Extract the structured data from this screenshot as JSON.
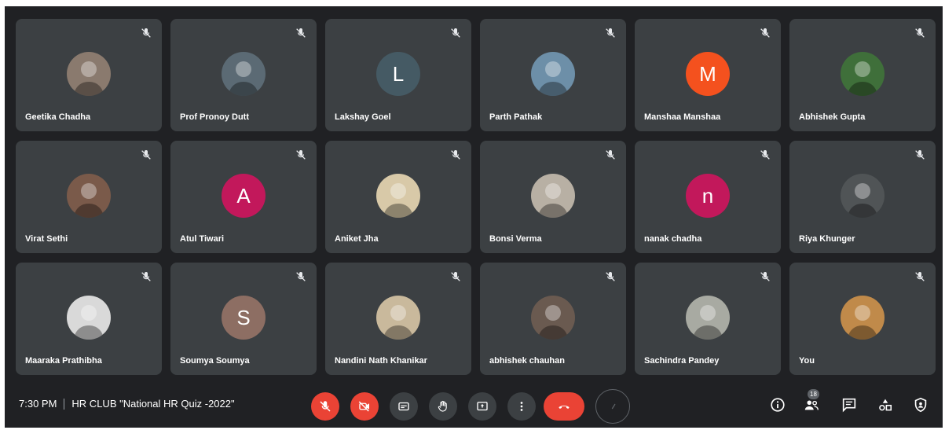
{
  "participants": [
    {
      "name": "Geetika Chadha",
      "avatar_type": "photo",
      "photo_bg": "#8a7a6e"
    },
    {
      "name": "Prof Pronoy Dutt",
      "avatar_type": "photo",
      "photo_bg": "#5b6a74"
    },
    {
      "name": "Lakshay Goel",
      "avatar_type": "initial",
      "initial": "L",
      "color": "#455a64"
    },
    {
      "name": "Parth Pathak",
      "avatar_type": "photo",
      "photo_bg": "#6d8fa8"
    },
    {
      "name": "Manshaa Manshaa",
      "avatar_type": "initial",
      "initial": "M",
      "color": "#f4511e"
    },
    {
      "name": "Abhishek Gupta",
      "avatar_type": "photo",
      "photo_bg": "#3f6f3a"
    },
    {
      "name": "Virat Sethi",
      "avatar_type": "photo",
      "photo_bg": "#7a5a4a"
    },
    {
      "name": "Atul Tiwari",
      "avatar_type": "initial",
      "initial": "A",
      "color": "#c2185b"
    },
    {
      "name": "Aniket Jha",
      "avatar_type": "photo",
      "photo_bg": "#d8c9a8"
    },
    {
      "name": "Bonsi Verma",
      "avatar_type": "photo",
      "photo_bg": "#b8b0a4"
    },
    {
      "name": "nanak chadha",
      "avatar_type": "initial",
      "initial": "n",
      "color": "#c2185b"
    },
    {
      "name": "Riya Khunger",
      "avatar_type": "photo",
      "photo_bg": "#505456"
    },
    {
      "name": "Maaraka Prathibha",
      "avatar_type": "photo",
      "photo_bg": "#d9d9d9"
    },
    {
      "name": "Soumya Soumya",
      "avatar_type": "initial",
      "initial": "S",
      "color": "#8d6e63"
    },
    {
      "name": "Nandini Nath Khanikar",
      "avatar_type": "photo",
      "photo_bg": "#c9b99c"
    },
    {
      "name": "abhishek chauhan",
      "avatar_type": "photo",
      "photo_bg": "#6a5a50"
    },
    {
      "name": "Sachindra Pandey",
      "avatar_type": "photo",
      "photo_bg": "#a8aaa2"
    },
    {
      "name": "You",
      "avatar_type": "photo",
      "photo_bg": "#c08a4a"
    }
  ],
  "meeting": {
    "time": "7:30 PM",
    "title": "HR CLUB \"National HR Quiz -2022\""
  },
  "controls": {
    "mic": "mic-off-icon",
    "camera": "camera-off-icon",
    "captions": "captions-icon",
    "raise_hand": "raise-hand-icon",
    "present": "present-screen-icon",
    "more": "more-options-icon",
    "end_call": "end-call-icon"
  },
  "right_controls": {
    "people_count": "18"
  },
  "colors": {
    "background": "#202124",
    "tile": "#3c4043",
    "danger": "#ea4335"
  }
}
